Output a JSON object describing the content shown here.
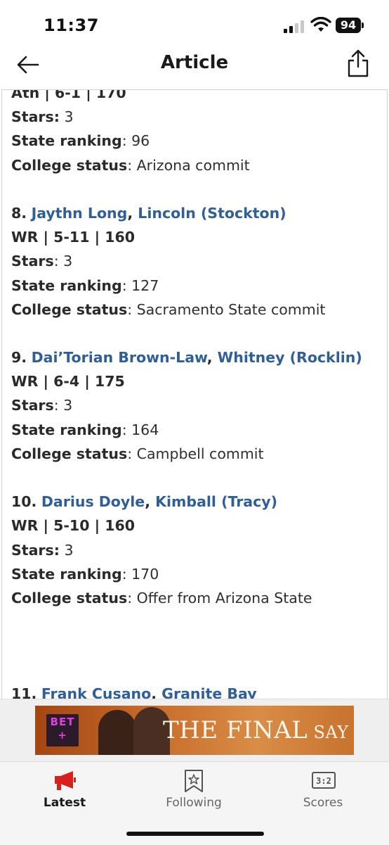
{
  "status_bar": {
    "time": "11:37",
    "battery": "94"
  },
  "nav": {
    "title": "Article"
  },
  "article": {
    "top_partial": "Ath | 6-1 | 170",
    "prev_player": {
      "stars_label": "Stars:",
      "stars_value": " 3",
      "ranking_label": "State ranking",
      "ranking_value": ": 96",
      "college_label": "College status",
      "college_value": ": Arizona commit"
    },
    "players": [
      {
        "rank": "8.",
        "name": "Jaythn Long",
        "school": "Lincoln (Stockton)",
        "position": "WR | 5-11 | 160",
        "stars_label": "Stars",
        "stars_value": ": 3",
        "ranking_label": "State ranking",
        "ranking_value": ": 127",
        "college_label": "College status",
        "college_value": ": Sacramento State commit"
      },
      {
        "rank": "9.",
        "name": "Dai’Torian Brown-Law",
        "school": "Whitney (Rocklin)",
        "position": "WR | 6-4 | 175",
        "stars_label": "Stars",
        "stars_value": ": 3",
        "ranking_label": "State ranking",
        "ranking_value": ": 164",
        "college_label": "College status",
        "college_value": ": Campbell commit"
      },
      {
        "rank": "10.",
        "name": "Darius Doyle",
        "school": "Kimball (Tracy)",
        "position": "WR | 5-10 | 160",
        "stars_label": "Stars:",
        "stars_value": " 3",
        "ranking_label": "State ranking",
        "ranking_value": ": 170",
        "college_label": "College status",
        "college_value": ": Offer from Arizona State"
      }
    ],
    "next_player": {
      "rank": "11.",
      "name": "Frank Cusano",
      "school": "Granite Bay"
    }
  },
  "ad": {
    "logo_line1": "BET",
    "logo_line2": "+",
    "title_main": "THE FINAL",
    "title_small": " SAY"
  },
  "tabs": [
    {
      "label": "Latest",
      "icon": "megaphone-icon",
      "active": true
    },
    {
      "label": "Following",
      "icon": "bookmark-star-icon",
      "active": false
    },
    {
      "label": "Scores",
      "icon": "scoreboard-icon",
      "active": false
    }
  ],
  "colors": {
    "link": "#2f5f96",
    "active_tab_icon": "#d8211c",
    "ad_bg": "#c76a2a"
  }
}
